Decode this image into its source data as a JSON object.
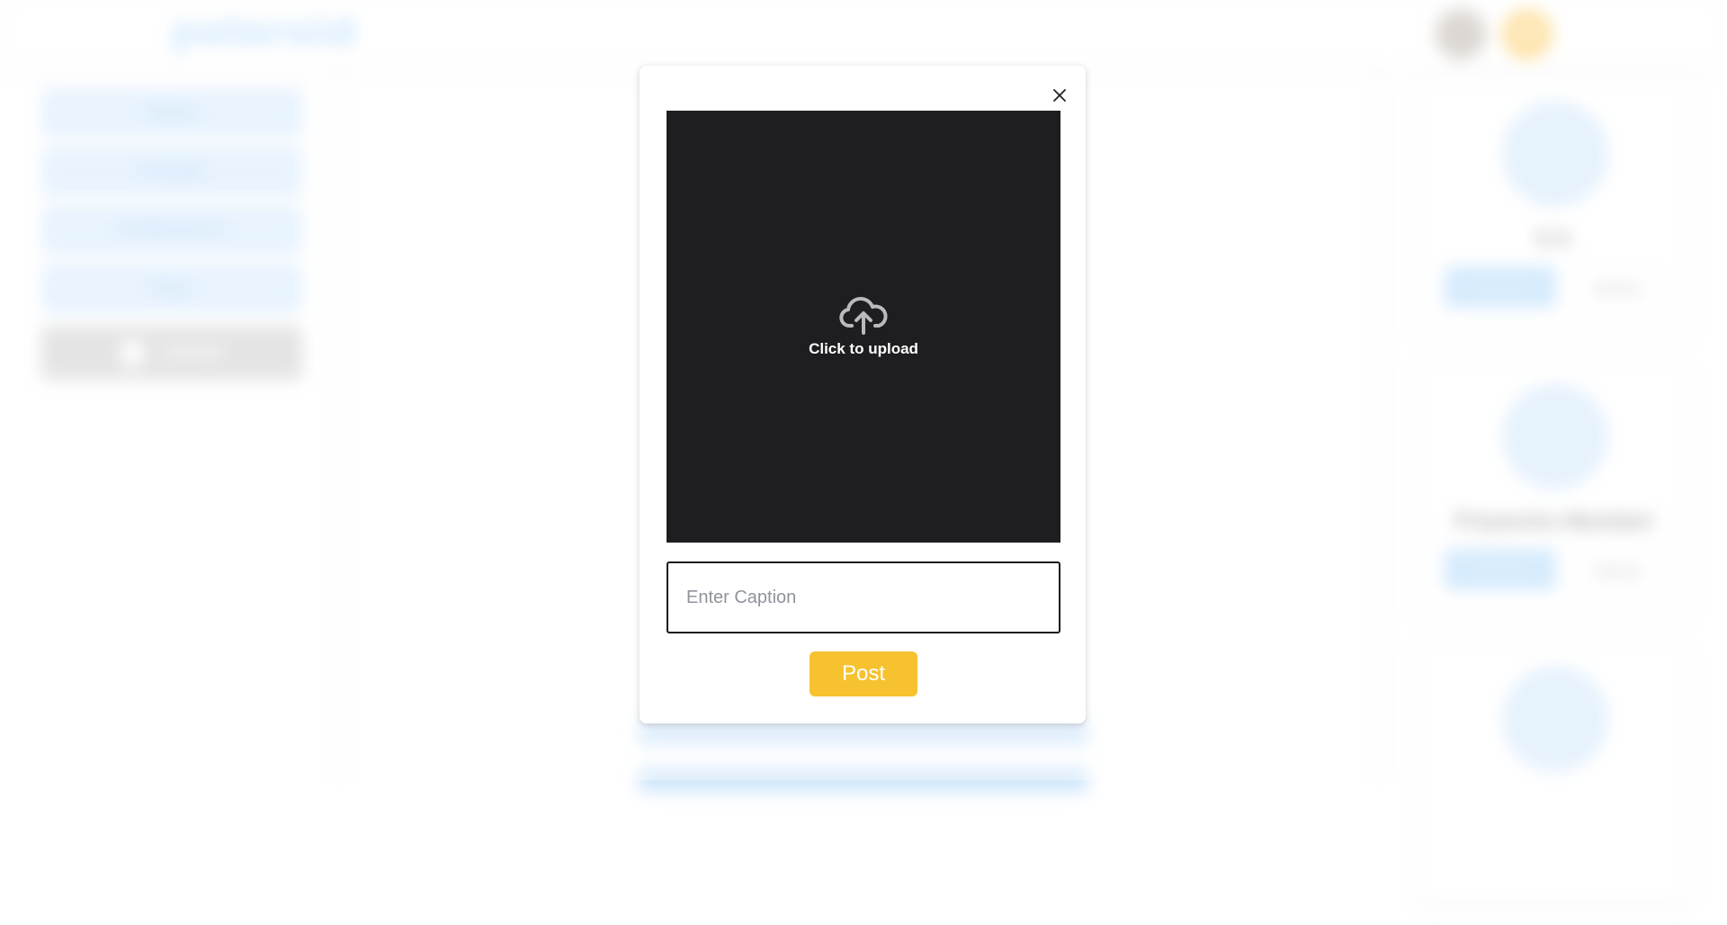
{
  "app": {
    "logo": "polaroid",
    "user_initials": "AP"
  },
  "nav": {
    "items": [
      "Home",
      "Friends",
      "Preferences",
      "Play"
    ],
    "github_label": "GitHub"
  },
  "suggestions": [
    {
      "name": "S A",
      "add_label": "Add friend",
      "remove_label": "Remove"
    },
    {
      "name": "Priyanshu Mandani",
      "add_label": "Add friend",
      "remove_label": "Remove"
    }
  ],
  "modal": {
    "upload_label": "Click to upload",
    "caption_placeholder": "Enter Caption",
    "post_label": "Post"
  },
  "colors": {
    "accent": "#f6c22f",
    "upload_bg": "#1e1e20",
    "brand_blue": "#b7dcfb"
  },
  "icons": {
    "close": "close-icon",
    "upload": "cloud-upload-icon"
  }
}
